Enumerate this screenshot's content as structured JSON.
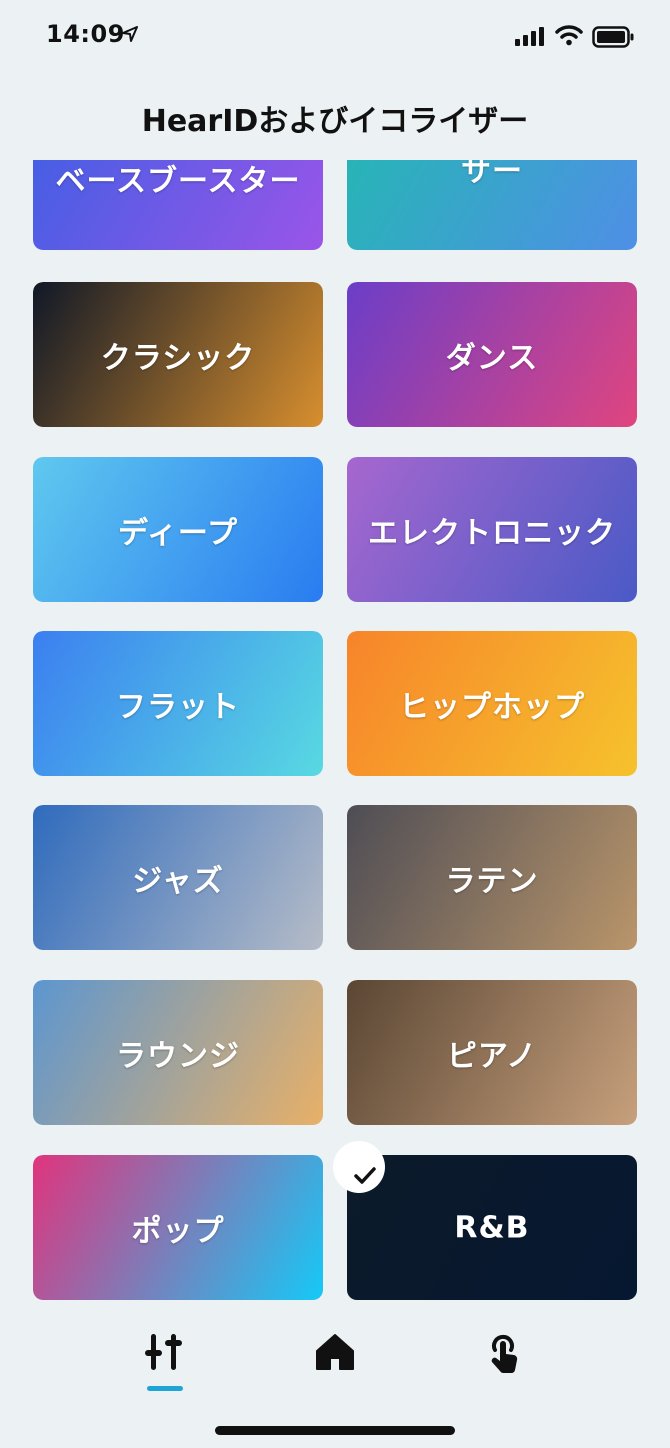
{
  "status": {
    "time": "14:09"
  },
  "page": {
    "title": "HearIDおよびイコライザー"
  },
  "presets": [
    {
      "label": "ベースブースター",
      "colors": [
        "#3f5fe4",
        "#9a55e8"
      ],
      "selected": false
    },
    {
      "label": "ベースリデューサー",
      "colors": [
        "#24b8b2",
        "#4f8fe6"
      ],
      "selected": false
    },
    {
      "label": "クラシック",
      "colors": [
        "#101827",
        "#d88f2e"
      ],
      "selected": false
    },
    {
      "label": "ダンス",
      "colors": [
        "#6b3ec8",
        "#e0457f"
      ],
      "selected": false
    },
    {
      "label": "ディープ",
      "colors": [
        "#5fc8ef",
        "#2a7cf0"
      ],
      "selected": false
    },
    {
      "label": "エレクトロニック",
      "colors": [
        "#a667cf",
        "#4a5ac6"
      ],
      "selected": false
    },
    {
      "label": "フラット",
      "colors": [
        "#3b7ff0",
        "#58d9e2"
      ],
      "selected": false
    },
    {
      "label": "ヒップホップ",
      "colors": [
        "#f7842b",
        "#f6c22c"
      ],
      "selected": false
    },
    {
      "label": "ジャズ",
      "colors": [
        "#2f6bbd",
        "#b6bcc7"
      ],
      "selected": false
    },
    {
      "label": "ラテン",
      "colors": [
        "#4e4d55",
        "#b9956a"
      ],
      "selected": false
    },
    {
      "label": "ラウンジ",
      "colors": [
        "#5c96d0",
        "#e8b067"
      ],
      "selected": false
    },
    {
      "label": "ピアノ",
      "colors": [
        "#5a4634",
        "#c7a07c"
      ],
      "selected": false
    },
    {
      "label": "ポップ",
      "colors": [
        "#e0347d",
        "#15c9f7"
      ],
      "selected": false
    },
    {
      "label": "R&B",
      "colors": [
        "#0c1a29",
        "#061731"
      ],
      "selected": true
    }
  ],
  "tabs": [
    {
      "name": "equalizer-tab",
      "icon": "equalizer-sliders-icon",
      "active": true
    },
    {
      "name": "home-tab",
      "icon": "home-icon",
      "active": false
    },
    {
      "name": "hearid-tab",
      "icon": "touch-hand-icon",
      "active": false
    }
  ],
  "colors": {
    "accent": "#1ea5d6",
    "background": "#ecf1f4"
  }
}
